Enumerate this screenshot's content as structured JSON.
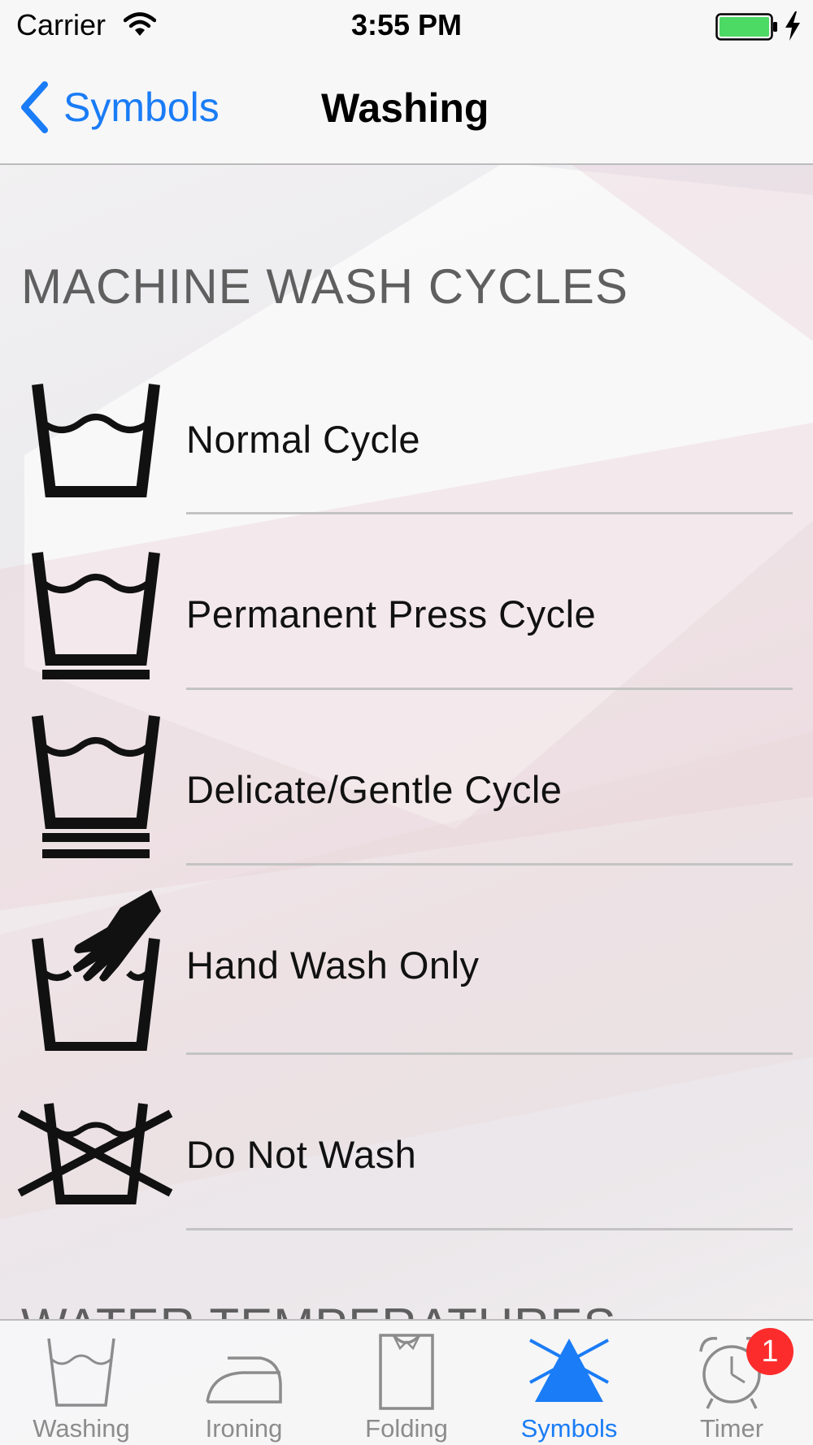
{
  "status_bar": {
    "carrier": "Carrier",
    "time": "3:55 PM",
    "icons": [
      "wifi-icon",
      "battery-icon",
      "charging-bolt-icon"
    ],
    "battery_color": "#4cd964"
  },
  "nav": {
    "back_label": "Symbols",
    "title": "Washing"
  },
  "sections": [
    {
      "header": "MACHINE WASH CYCLES",
      "items": [
        {
          "label": "Normal Cycle",
          "icon": "wash-tub-icon"
        },
        {
          "label": "Permanent Press Cycle",
          "icon": "permanent-press-icon"
        },
        {
          "label": "Delicate/Gentle Cycle",
          "icon": "delicate-cycle-icon"
        },
        {
          "label": "Hand Wash Only",
          "icon": "hand-wash-icon"
        },
        {
          "label": "Do Not Wash",
          "icon": "do-not-wash-icon"
        }
      ]
    },
    {
      "header": "WATER TEMPERATURES"
    }
  ],
  "tabs": [
    {
      "label": "Washing",
      "icon": "wash-tub-icon",
      "active": false
    },
    {
      "label": "Ironing",
      "icon": "iron-icon",
      "active": false
    },
    {
      "label": "Folding",
      "icon": "folded-shirt-icon",
      "active": false
    },
    {
      "label": "Symbols",
      "icon": "symbols-icon",
      "active": true
    },
    {
      "label": "Timer",
      "icon": "alarm-clock-icon",
      "active": false,
      "badge": "1"
    }
  ],
  "colors": {
    "accent": "#1a7cf6",
    "badge": "#fd2c2c",
    "inactive_tab": "#8c8c8c",
    "section_header": "#5f5f5f"
  }
}
